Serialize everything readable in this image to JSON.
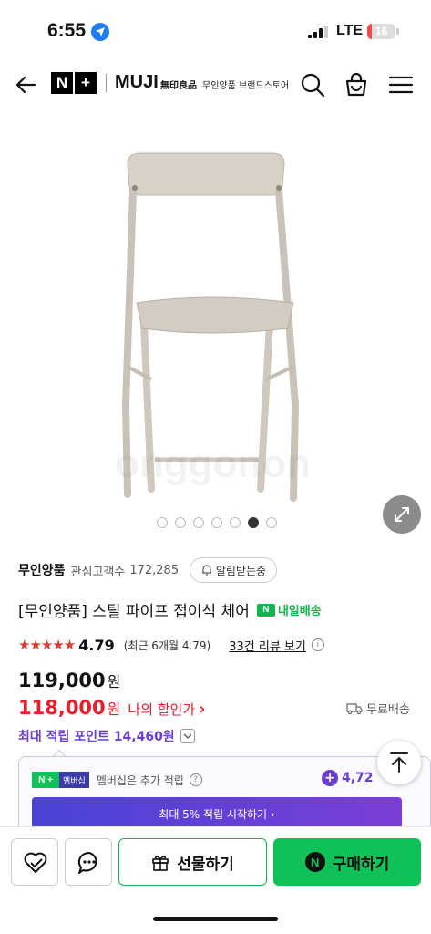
{
  "status_bar": {
    "time": "6:55",
    "network": "LTE",
    "battery": "16",
    "battery_level": 0.16
  },
  "header": {
    "logo_n": "N",
    "logo_plus": "+",
    "brand_logo": "MUJI",
    "brand_kanji": "無印良品",
    "store_name": "무인양품 브랜드스토어"
  },
  "gallery": {
    "watermark": "onggonon",
    "slide_count": 7,
    "active_slide": 6
  },
  "product": {
    "brand": "무인양품",
    "watchers_label": "관심고객수",
    "watchers_count": "172,285",
    "alarm_label": "알림받는중",
    "title": "[무인양품] 스틸 파이프 접이식 체어",
    "delivery_icon": "N",
    "delivery_label": "내일배송",
    "stars": "★★★★★",
    "rating": "4.79",
    "recent_rating": "(최근 6개월 4.79)",
    "reviews_link": "33건 리뷰 보기",
    "info_glyph": "i",
    "original_price": "119,000",
    "sale_price": "118,000",
    "currency": "원",
    "my_discount": "나의 할인가",
    "my_discount_chevron": "›",
    "shipping": "무료배송",
    "points": "최대 적립 포인트 14,460원",
    "points_chevron": "⌄"
  },
  "membership": {
    "badge_n": "N +",
    "badge_text": "멤버십",
    "text": "멤버십은 추가 적립",
    "info_glyph": "?",
    "plus": "+",
    "amount": "4,72",
    "cta": "최대 5% 적립 시작하기 ›"
  },
  "bottom_bar": {
    "gift_label": "선물하기",
    "buy_icon": "N",
    "buy_label": "구매하기"
  },
  "colors": {
    "accent_green": "#10c157",
    "sale_red": "#e8202e",
    "points_purple": "#6a3fcf"
  }
}
